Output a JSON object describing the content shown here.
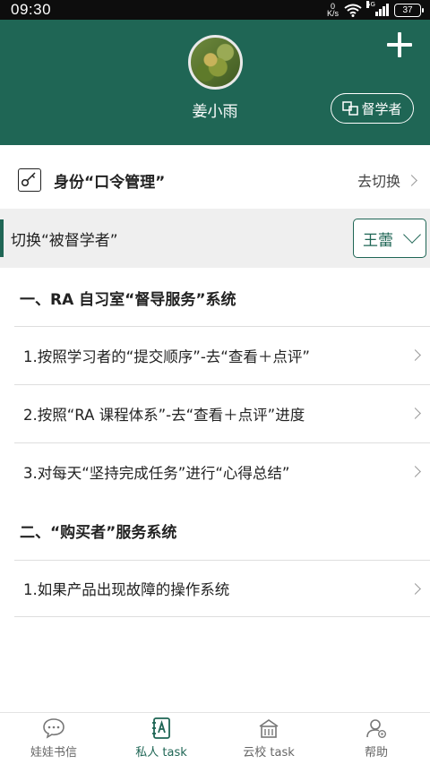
{
  "status_bar": {
    "time": "09:30",
    "net_speed_value": "0",
    "net_speed_unit": "K/s",
    "network_type": "5G",
    "battery": "37"
  },
  "header": {
    "add_icon": "plus-icon",
    "avatar_icon": "user-avatar",
    "username": "姜小雨",
    "supervisor_button_label": "督学者",
    "background_color": "#1f6655"
  },
  "identity": {
    "title": "身份“口令管理”",
    "action_label": "去切换",
    "icon": "key-icon"
  },
  "supervised": {
    "label": "切换“被督学者”",
    "selected_student": "王蕾"
  },
  "sections": [
    {
      "title": "一、RA 自习室“督导服务”系统",
      "items": [
        "1.按照学习者的“提交顺序”-去“查看＋点评”",
        "2.按照“RA 课程体系”-去“查看＋点评”进度",
        "3.对每天“坚持完成任务”进行“心得总结”"
      ]
    },
    {
      "title": "二、“购买者”服务系统",
      "items": [
        "1.如果产品出现故障的操作系统"
      ]
    }
  ],
  "bottom_nav": [
    {
      "label": "娃娃书信",
      "icon": "chat-bubble-icon",
      "active": false
    },
    {
      "label": "私人 task",
      "icon": "notebook-icon",
      "active": true
    },
    {
      "label": "云校 task",
      "icon": "school-building-icon",
      "active": false
    },
    {
      "label": "帮助",
      "icon": "user-help-icon",
      "active": false
    }
  ]
}
